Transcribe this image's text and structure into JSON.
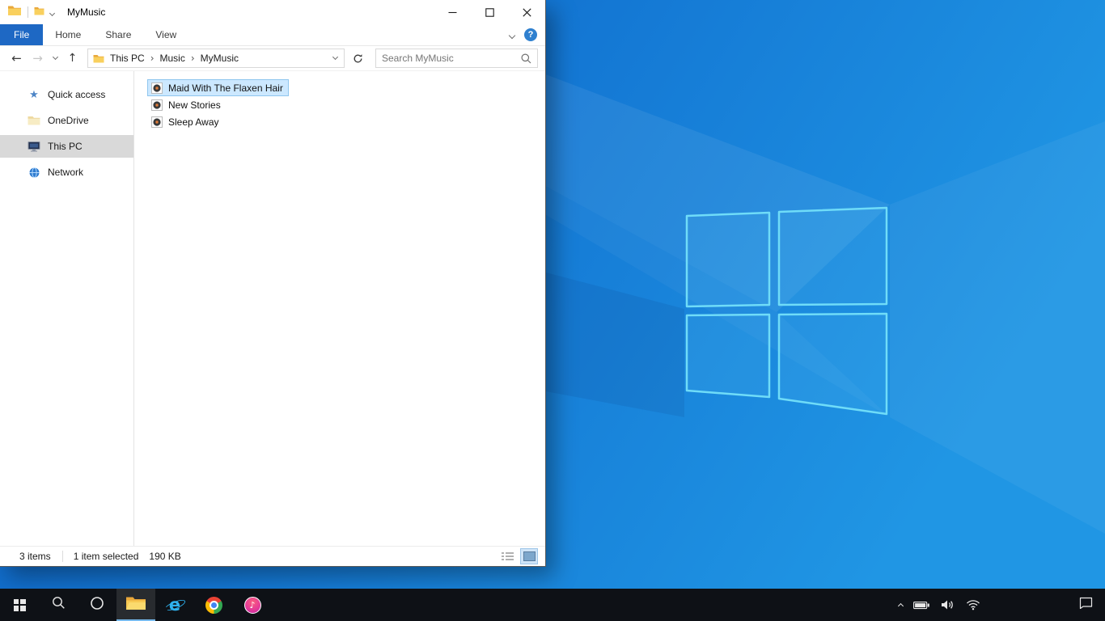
{
  "window": {
    "title": "MyMusic",
    "controls": {
      "minimize": "Minimize",
      "maximize": "Maximize",
      "close": "Close"
    }
  },
  "ribbon": {
    "tabs": [
      {
        "label": "File",
        "active": true
      },
      {
        "label": "Home",
        "active": false
      },
      {
        "label": "Share",
        "active": false
      },
      {
        "label": "View",
        "active": false
      }
    ],
    "help_glyph": "?"
  },
  "address": {
    "breadcrumbs": [
      "This PC",
      "Music",
      "MyMusic"
    ],
    "crumb_sep": "›",
    "search_placeholder": "Search MyMusic"
  },
  "glyphs": {
    "back": "←",
    "forward": "→",
    "up": "↑",
    "star": "★",
    "note": "♪",
    "ie": "e"
  },
  "sidebar": {
    "items": [
      {
        "label": "Quick access",
        "icon": "star-icon",
        "selected": false
      },
      {
        "label": "OneDrive",
        "icon": "folder-icon",
        "selected": false
      },
      {
        "label": "This PC",
        "icon": "computer-icon",
        "selected": true
      },
      {
        "label": "Network",
        "icon": "network-icon",
        "selected": false
      }
    ]
  },
  "files": {
    "items": [
      {
        "name": "Maid With The Flaxen Hair",
        "icon": "media-file-icon",
        "selected": true
      },
      {
        "name": "New Stories",
        "icon": "media-file-icon",
        "selected": false
      },
      {
        "name": "Sleep Away",
        "icon": "media-file-icon",
        "selected": false
      }
    ]
  },
  "statusbar": {
    "items_count": "3 items",
    "selection": "1 item selected",
    "size": "190 KB"
  },
  "taskbar": {
    "buttons": [
      "start",
      "search",
      "cortana",
      "file-explorer",
      "internet-explorer",
      "chrome",
      "itunes"
    ],
    "active_button": "file-explorer",
    "tray": [
      "hidden-icons-chevron",
      "battery",
      "volume",
      "wifi",
      "action-center"
    ]
  },
  "colors": {
    "file_tab_blue": "#1e68c4",
    "selection_bg": "#cce8ff",
    "selection_border": "#8fc6ee",
    "sidebar_selection": "#d9d9d9",
    "taskbar_bg": "#0e1116",
    "desktop_blue": "#1478d4",
    "logo_outline": "#6fdcf8"
  }
}
